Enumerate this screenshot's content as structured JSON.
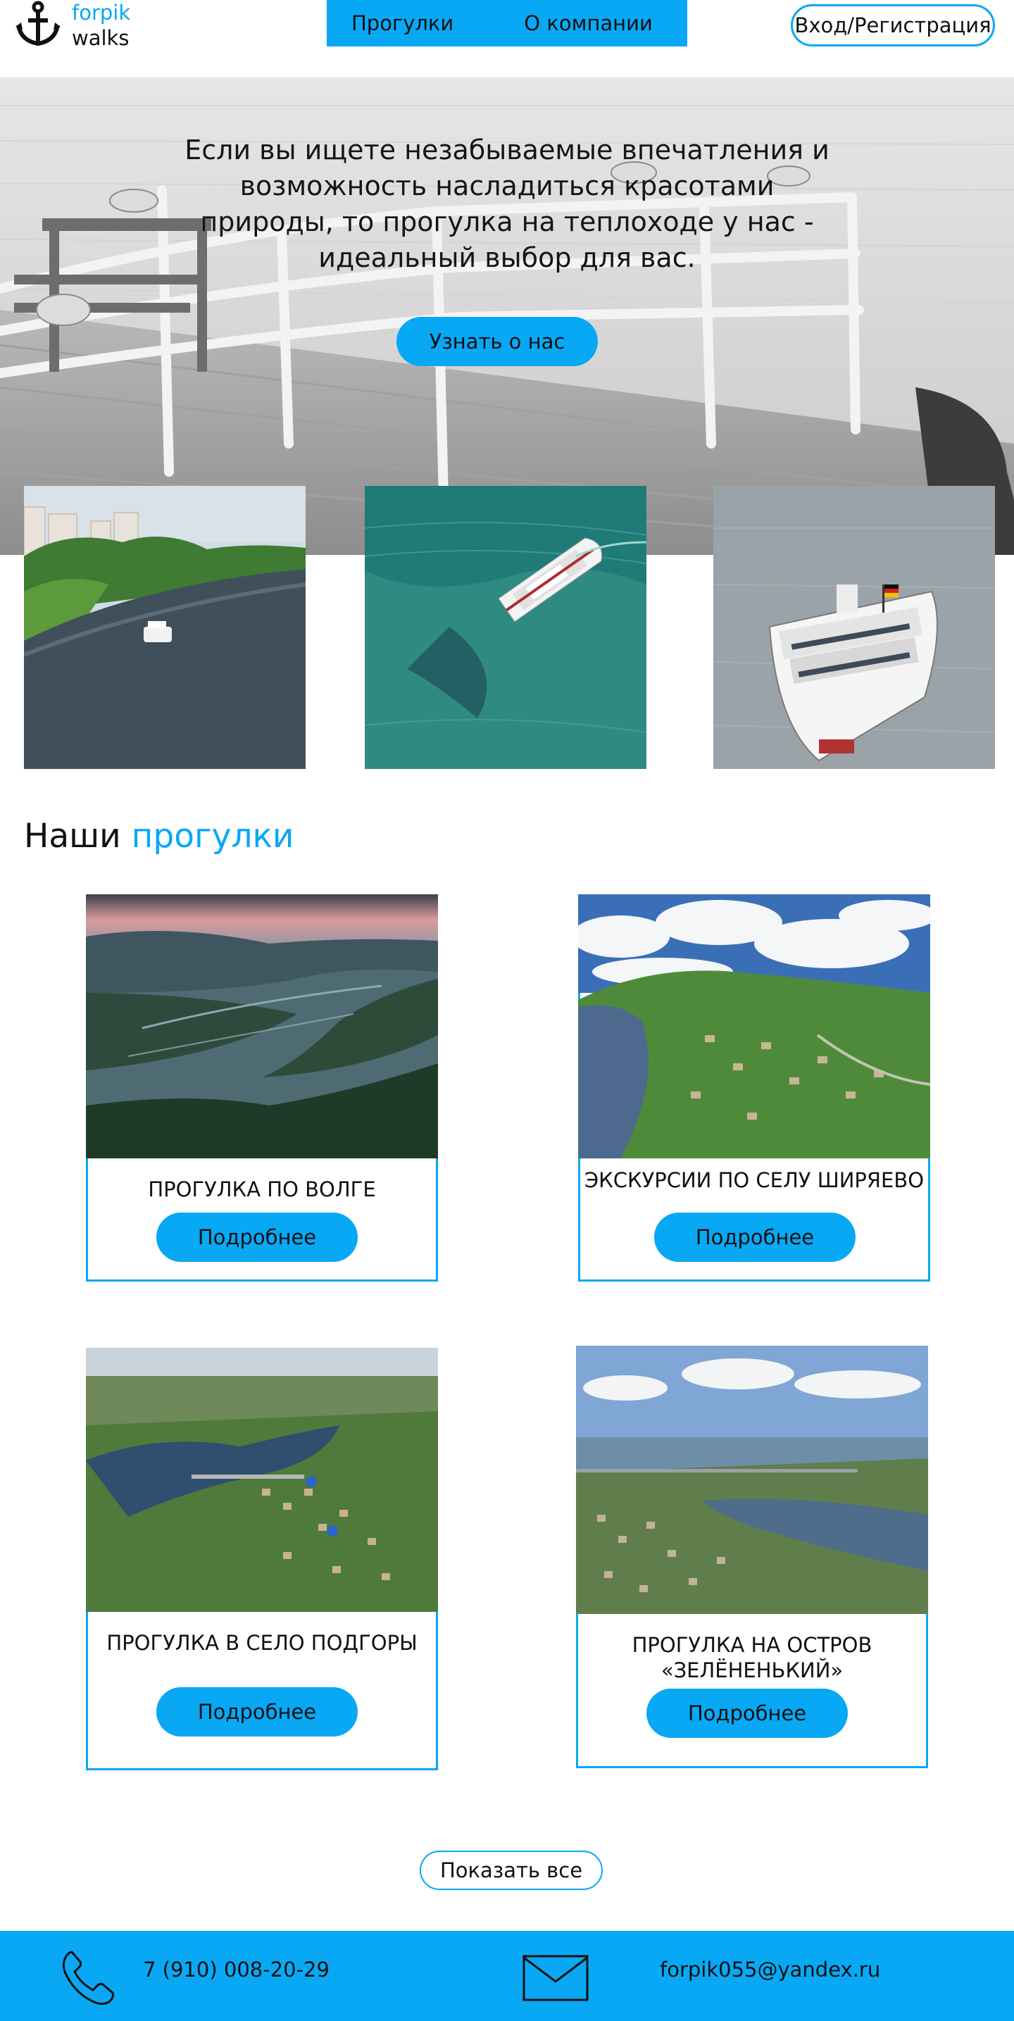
{
  "brand": {
    "line1": "forpik",
    "line2": "walks",
    "logo_icon": "anchor-icon",
    "accent_color": "#08a8f4"
  },
  "nav": {
    "items": [
      "Прогулки",
      "О компании"
    ]
  },
  "header": {
    "login_label": "Вход/Регистрация"
  },
  "hero": {
    "text": "Если вы ищете незабываемые впечатления и возможность насладиться красотами природы, то прогулка на теплоходе у нас - идеальный выбор для вас.",
    "button_label": "Узнать о нас"
  },
  "section": {
    "title_prefix": "Наши",
    "title_accent": "прогулки"
  },
  "tours": [
    {
      "title": "ПРОГУЛКА ПО ВОЛГЕ",
      "button": "Подробнее"
    },
    {
      "title": "ЭКСКУРСИИ ПО СЕЛУ ШИРЯЕВО",
      "button": "Подробнее"
    },
    {
      "title": "ПРОГУЛКА В СЕЛО ПОДГОРЫ",
      "button": "Подробнее"
    },
    {
      "title": "ПРОГУЛКА НА ОСТРОВ «ЗЕЛЁНЕНЬКИЙ»",
      "button": "Подробнее"
    }
  ],
  "show_all_label": "Показать все",
  "footer": {
    "phone": "7 (910) 008-20-29",
    "email": "forpik055@yandex.ru",
    "phone_icon": "phone-icon",
    "mail_icon": "mail-icon"
  }
}
